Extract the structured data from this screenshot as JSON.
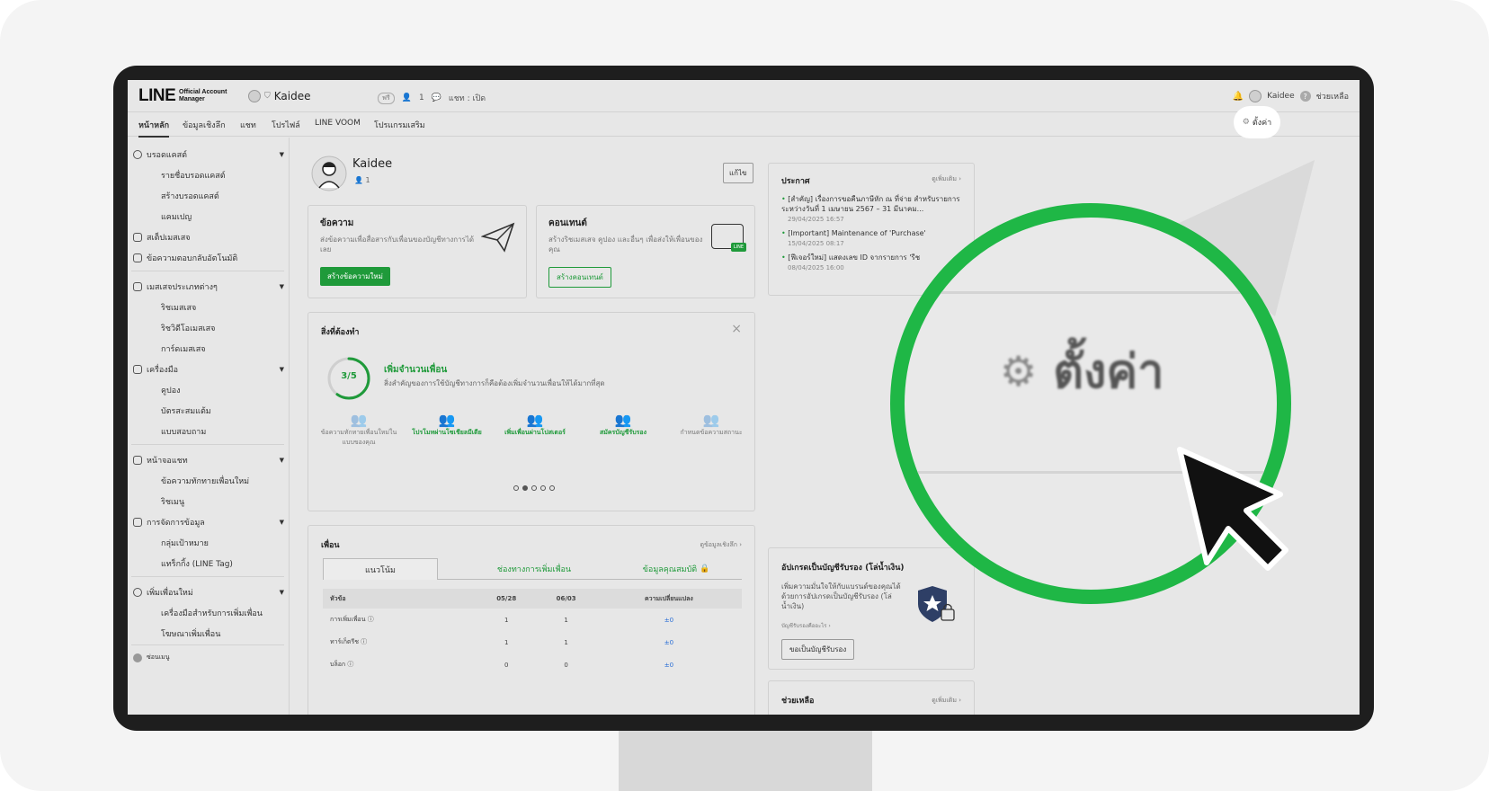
{
  "topbar": {
    "logo_main": "LINE",
    "logo_sub_1": "Official Account",
    "logo_sub_2": "Manager",
    "account_name": "Kaidee",
    "badge_text": "ฟรี",
    "friends_count": "1",
    "chat_status": "แชท : เปิด",
    "user_name": "Kaidee",
    "help_label": "ช่วยเหลือ"
  },
  "nav": {
    "tabs": [
      "หน้าหลัก",
      "ข้อมูลเชิงลึก",
      "แชท",
      "โปรไฟล์",
      "LINE VOOM",
      "โปรแกรมเสริม"
    ],
    "settings_label": "ตั้งค่า"
  },
  "sidebar": {
    "broadcast": "บรอดแคสต์",
    "broadcast_list": "รายชื่อบรอดแคสต์",
    "broadcast_create": "สร้างบรอดแคสต์",
    "campaign": "แคมเปญ",
    "step_message": "สเต็ปเมสเสจ",
    "auto_reply": "ข้อความตอบกลับอัตโนมัติ",
    "message_types": "เมสเสจประเภทต่างๆ",
    "rich_message": "ริชเมสเสจ",
    "rich_video": "ริชวิดีโอเมสเสจ",
    "card_message": "การ์ดเมสเสจ",
    "tools": "เครื่องมือ",
    "coupon": "คูปอง",
    "reward_card": "บัตรสะสมแต้ม",
    "survey": "แบบสอบถาม",
    "chat_screen": "หน้าจอแชท",
    "greeting": "ข้อความทักทายเพื่อนใหม่",
    "rich_menu": "ริชเมนู",
    "data_mgmt": "การจัดการข้อมูล",
    "audience": "กลุ่มเป้าหมาย",
    "line_tag": "แทร็กกิ้ง (LINE Tag)",
    "add_friends": "เพิ่มเพื่อนใหม่",
    "add_friend_tools": "เครื่องมือสำหรับการเพิ่มเพื่อน",
    "friend_ads": "โฆษณาเพิ่มเพื่อน",
    "collapse": "ซ่อนเมนู"
  },
  "profile": {
    "name": "Kaidee",
    "friends": "1",
    "edit_label": "แก้ไข"
  },
  "message_card": {
    "title": "ข้อความ",
    "desc": "ส่งข้อความเพื่อสื่อสารกับเพื่อนของบัญชีทางการได้เลย",
    "button": "สร้างข้อความใหม่"
  },
  "content_card": {
    "title": "คอนเทนต์",
    "desc": "สร้างริชเมสเสจ คูปอง และอื่นๆ เพื่อส่งให้เพื่อนของคุณ",
    "button": "สร้างคอนเทนต์",
    "icon_text": "LINE"
  },
  "todo": {
    "title": "สิ่งที่ต้องทำ",
    "progress": "3/5",
    "progress_value": 0.6,
    "heading": "เพิ่มจำนวนเพื่อน",
    "desc": "สิ่งสำคัญของการใช้บัญชีทางการก็คือต้องเพิ่มจำนวนเพื่อนให้ได้มากที่สุด",
    "steps": [
      {
        "label": "ข้อความทักทายเพื่อนใหม่ในแบบของคุณ",
        "done": false
      },
      {
        "label": "โปรโมทผ่านโซเชียลมีเดีย",
        "done": true
      },
      {
        "label": "เพิ่มเพื่อนผ่านโปสเตอร์",
        "done": true
      },
      {
        "label": "สมัครบัญชีรับรอง",
        "done": true
      },
      {
        "label": "กำหนดข้อความสถานะ",
        "done": false
      }
    ]
  },
  "friends": {
    "title": "เพื่อน",
    "more_link": "ดูข้อมูลเชิงลึก",
    "tabs": [
      "แนวโน้ม",
      "ช่องทางการเพิ่มเพื่อน",
      "ข้อมูลคุณสมบัติ"
    ],
    "columns": [
      "หัวข้อ",
      "05/28",
      "06/03",
      "ความเปลี่ยนแปลง"
    ],
    "rows": [
      {
        "label": "การเพิ่มเพื่อน",
        "a": "1",
        "b": "1",
        "change": "±0"
      },
      {
        "label": "ทาร์เก็ตรีช",
        "a": "1",
        "b": "1",
        "change": "±0"
      },
      {
        "label": "บล็อก",
        "a": "0",
        "b": "0",
        "change": "±0"
      }
    ]
  },
  "announcements": {
    "title": "ประกาศ",
    "more_link": "ดูเพิ่มเติม",
    "items": [
      {
        "text": "[สำคัญ] เรื่องการขอคืนภาษีหัก ณ ที่จ่าย สำหรับรายการระหว่างวันที่ 1 เมษายน 2567 – 31 มีนาคม...",
        "date": "29/04/2025 16:57"
      },
      {
        "text": "[Important] Maintenance of 'Purchase'",
        "date": "15/04/2025 08:17"
      },
      {
        "text": "[ฟีเจอร์ใหม่] แสดงเลข ID จากรายการ 'รีช",
        "date": "08/04/2025 16:00"
      }
    ]
  },
  "upgrade": {
    "title": "อัปเกรดเป็นบัญชีรับรอง (โล่น้ำเงิน)",
    "desc": "เพิ่มความมั่นใจให้กับแบรนด์ของคุณได้ด้วยการอัปเกรดเป็นบัญชีรับรอง (โล่น้ำเงิน)",
    "link": "บัญชีรับรองคืออะไร",
    "button": "ขอเป็นบัญชีรับรอง"
  },
  "help_panel": {
    "title": "ช่วยเหลือ",
    "more_link": "ดูเพิ่มเติม"
  },
  "magnifier": {
    "label": "ตั้งค่า"
  },
  "colors": {
    "accent_green": "#1fb746",
    "button_green": "#1f9a3a"
  }
}
